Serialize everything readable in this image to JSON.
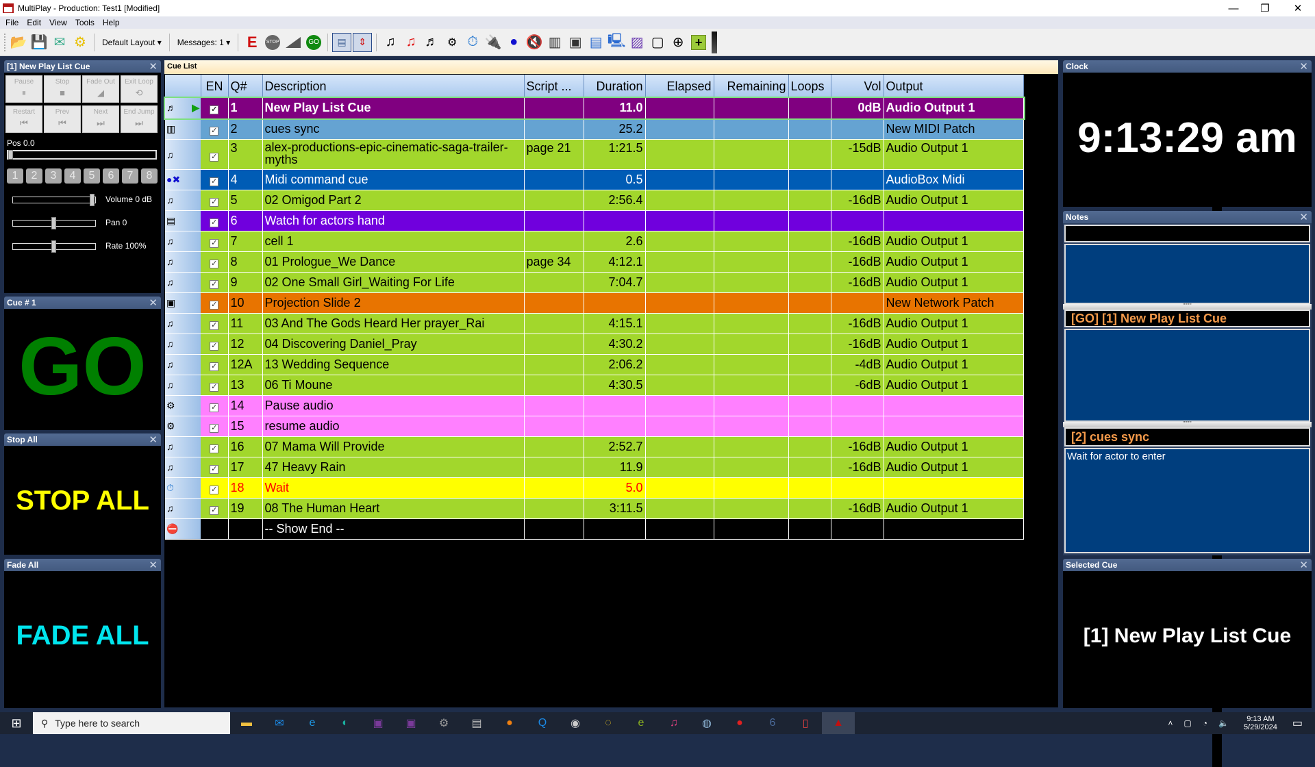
{
  "window": {
    "title": "MultiPlay - Production: Test1 [Modified]",
    "controls": {
      "minimize": "—",
      "restore": "❐",
      "close": "✕"
    }
  },
  "menu": [
    "File",
    "Edit",
    "View",
    "Tools",
    "Help"
  ],
  "toolbar": {
    "layout_dropdown": "Default Layout",
    "messages_dropdown": "Messages: 1",
    "icons": [
      "open-folder-icon",
      "save-icon",
      "export-icon",
      "settings-gear-icon",
      "edit-e-icon",
      "stop-icon",
      "fade-icon",
      "go-icon",
      "list-view-icon",
      "collapse-icon",
      "audio-cue-icon",
      "audio-cue-red-icon",
      "playlist-cue-icon",
      "control-cue-icon",
      "wait-cue-icon",
      "usb-cue-icon",
      "midi-cue-icon",
      "midi-stop-icon",
      "piano-icon",
      "network-cue-icon",
      "text-doc-icon",
      "computer-settings-icon",
      "image-cue-icon",
      "comment-icon",
      "globe-icon",
      "add-icon"
    ]
  },
  "left_panels": {
    "playback": {
      "title": "[1] New Play List Cue",
      "buttons": [
        {
          "label": "Pause",
          "icon": "⏸"
        },
        {
          "label": "Stop",
          "icon": "■"
        },
        {
          "label": "Fade Out",
          "icon": "◢"
        },
        {
          "label": "Exit Loop",
          "icon": "⟲"
        },
        {
          "label": "Restart",
          "icon": "⏮"
        },
        {
          "label": "Prev",
          "icon": "⏮"
        },
        {
          "label": "Next",
          "icon": "⏭"
        },
        {
          "label": "End Jump",
          "icon": "⏭"
        }
      ],
      "position_label": "Pos 0.0",
      "position_fraction": 0.0,
      "number_buttons": [
        "1",
        "2",
        "3",
        "4",
        "5",
        "6",
        "7",
        "8"
      ],
      "volume_label": "Volume 0 dB",
      "volume_fraction": 1.0,
      "pan_label": "Pan 0",
      "pan_fraction": 0.5,
      "rate_label": "Rate 100%",
      "rate_fraction": 0.5
    },
    "cue_number": {
      "title": "Cue # 1",
      "text": "GO",
      "color": "#008000"
    },
    "stop_all": {
      "title": "Stop All",
      "text": "STOP ALL",
      "color": "#ffff00"
    },
    "fade_all": {
      "title": "Fade All",
      "text": "FADE ALL",
      "color": "#00e5ee"
    }
  },
  "cue_list": {
    "title": "Cue List",
    "columns": [
      "",
      "EN",
      "Q#",
      "Description",
      "Script ...",
      "Duration",
      "Elapsed",
      "Remaining",
      "Loops",
      "Vol",
      "Output"
    ],
    "rows": [
      {
        "icon": "♬",
        "type": "playlist-cue-icon",
        "running": true,
        "en": true,
        "q": "1",
        "desc": "New Play List Cue",
        "script": "",
        "duration": "11.0",
        "elapsed": "",
        "remaining": "",
        "loops": "",
        "vol": "0dB",
        "output": "Audio Output 1",
        "bg": "#800080",
        "fg": "#ffffff",
        "bold": true
      },
      {
        "icon": "▥",
        "type": "midi-piano-icon",
        "en": true,
        "q": "2",
        "desc": "cues sync",
        "script": "",
        "duration": "25.2",
        "elapsed": "",
        "remaining": "",
        "loops": "",
        "vol": "",
        "output": "New MIDI Patch",
        "bg": "#65a3d2",
        "fg": "#000000"
      },
      {
        "icon": "♫",
        "type": "audio-cue-icon",
        "en": true,
        "q": "3",
        "desc": "alex-productions-epic-cinematic-saga-trailer-myths",
        "script": "page 21",
        "duration": "1:21.5",
        "elapsed": "",
        "remaining": "",
        "loops": "",
        "vol": "-15dB",
        "output": "Audio Output 1",
        "bg": "#a2d72c",
        "fg": "#000000",
        "tall": true
      },
      {
        "icon": "●✖",
        "type": "midi-command-icon",
        "en": true,
        "q": "4",
        "desc": "Midi command cue",
        "script": "",
        "duration": "0.5",
        "elapsed": "",
        "remaining": "",
        "loops": "",
        "vol": "",
        "output": "AudioBox Midi",
        "bg": "#005cb5",
        "fg": "#ffffff"
      },
      {
        "icon": "♫",
        "type": "audio-cue-icon",
        "en": true,
        "q": "5",
        "desc": "02 Omigod Part 2",
        "script": "",
        "duration": "2:56.4",
        "elapsed": "",
        "remaining": "",
        "loops": "",
        "vol": "-16dB",
        "output": "Audio Output 1",
        "bg": "#a2d72c",
        "fg": "#000000"
      },
      {
        "icon": "▤",
        "type": "text-cue-icon",
        "en": true,
        "q": "6",
        "desc": "Watch for actors hand",
        "script": "",
        "duration": "",
        "elapsed": "",
        "remaining": "",
        "loops": "",
        "vol": "",
        "output": "",
        "bg": "#7000dd",
        "fg": "#ffffff"
      },
      {
        "icon": "♫",
        "type": "audio-cue-icon",
        "en": true,
        "q": "7",
        "desc": "cell 1",
        "script": "",
        "duration": "2.6",
        "elapsed": "",
        "remaining": "",
        "loops": "",
        "vol": "-16dB",
        "output": "Audio Output 1",
        "bg": "#a2d72c",
        "fg": "#000000"
      },
      {
        "icon": "♫",
        "type": "audio-cue-icon",
        "en": true,
        "q": "8",
        "desc": "01 Prologue_We Dance",
        "script": "page 34",
        "duration": "4:12.1",
        "elapsed": "",
        "remaining": "",
        "loops": "",
        "vol": "-16dB",
        "output": "Audio Output 1",
        "bg": "#a2d72c",
        "fg": "#000000"
      },
      {
        "icon": "♫",
        "type": "audio-cue-icon",
        "en": true,
        "q": "9",
        "desc": "02 One Small Girl_Waiting For Life",
        "script": "",
        "duration": "7:04.7",
        "elapsed": "",
        "remaining": "",
        "loops": "",
        "vol": "-16dB",
        "output": "Audio Output 1",
        "bg": "#a2d72c",
        "fg": "#000000"
      },
      {
        "icon": "▣",
        "type": "network-cue-icon",
        "en": true,
        "q": "10",
        "desc": "Projection Slide 2",
        "script": "",
        "duration": "",
        "elapsed": "",
        "remaining": "",
        "loops": "",
        "vol": "",
        "output": "New Network Patch",
        "bg": "#e87400",
        "fg": "#000000"
      },
      {
        "icon": "♫",
        "type": "audio-cue-icon",
        "en": true,
        "q": "11",
        "desc": "03 And The Gods Heard Her prayer_Rai",
        "script": "",
        "duration": "4:15.1",
        "elapsed": "",
        "remaining": "",
        "loops": "",
        "vol": "-16dB",
        "output": "Audio Output 1",
        "bg": "#a2d72c",
        "fg": "#000000"
      },
      {
        "icon": "♫",
        "type": "audio-cue-icon",
        "en": true,
        "q": "12",
        "desc": "04 Discovering Daniel_Pray",
        "script": "",
        "duration": "4:30.2",
        "elapsed": "",
        "remaining": "",
        "loops": "",
        "vol": "-16dB",
        "output": "Audio Output 1",
        "bg": "#a2d72c",
        "fg": "#000000"
      },
      {
        "icon": "♫",
        "type": "audio-cue-icon",
        "en": true,
        "q": "12A",
        "desc": "13 Wedding Sequence",
        "script": "",
        "duration": "2:06.2",
        "elapsed": "",
        "remaining": "",
        "loops": "",
        "vol": "-4dB",
        "output": "Audio Output 1",
        "bg": "#a2d72c",
        "fg": "#000000"
      },
      {
        "icon": "♫",
        "type": "audio-cue-icon",
        "en": true,
        "q": "13",
        "desc": "06 Ti Moune",
        "script": "",
        "duration": "4:30.5",
        "elapsed": "",
        "remaining": "",
        "loops": "",
        "vol": "-6dB",
        "output": "Audio Output 1",
        "bg": "#a2d72c",
        "fg": "#000000"
      },
      {
        "icon": "⚙",
        "type": "control-cue-icon",
        "en": true,
        "q": "14",
        "desc": "Pause audio",
        "script": "",
        "duration": "",
        "elapsed": "",
        "remaining": "",
        "loops": "",
        "vol": "",
        "output": "",
        "bg": "#ff80ff",
        "fg": "#000000"
      },
      {
        "icon": "⚙",
        "type": "control-cue-icon",
        "en": true,
        "q": "15",
        "desc": "resume audio",
        "script": "",
        "duration": "",
        "elapsed": "",
        "remaining": "",
        "loops": "",
        "vol": "",
        "output": "",
        "bg": "#ff80ff",
        "fg": "#000000"
      },
      {
        "icon": "♫",
        "type": "audio-cue-icon",
        "en": true,
        "q": "16",
        "desc": "07 Mama Will Provide",
        "script": "",
        "duration": "2:52.7",
        "elapsed": "",
        "remaining": "",
        "loops": "",
        "vol": "-16dB",
        "output": "Audio Output 1",
        "bg": "#a2d72c",
        "fg": "#000000"
      },
      {
        "icon": "♫",
        "type": "audio-cue-icon",
        "en": true,
        "q": "17",
        "desc": "47 Heavy Rain",
        "script": "",
        "duration": "11.9",
        "elapsed": "",
        "remaining": "",
        "loops": "",
        "vol": "-16dB",
        "output": "Audio Output 1",
        "bg": "#a2d72c",
        "fg": "#000000"
      },
      {
        "icon": "⏱",
        "type": "wait-cue-icon",
        "en": true,
        "q": "18",
        "desc": "Wait",
        "script": "",
        "duration": "5.0",
        "elapsed": "",
        "remaining": "",
        "loops": "",
        "vol": "",
        "output": "",
        "bg": "#ffff00",
        "fg": "#ff0000"
      },
      {
        "icon": "♫",
        "type": "audio-cue-icon",
        "en": true,
        "q": "19",
        "desc": "08 The Human Heart",
        "script": "",
        "duration": "3:11.5",
        "elapsed": "",
        "remaining": "",
        "loops": "",
        "vol": "-16dB",
        "output": "Audio Output 1",
        "bg": "#a2d72c",
        "fg": "#000000"
      },
      {
        "icon": "⛔",
        "type": "show-end-icon",
        "en": null,
        "q": "",
        "desc": "-- Show End --",
        "script": "",
        "duration": "",
        "elapsed": "",
        "remaining": "",
        "loops": "",
        "vol": "",
        "output": "",
        "bg": "#000000",
        "fg": "#ffffff"
      }
    ]
  },
  "right_panels": {
    "clock": {
      "title": "Clock",
      "time": "9:13:29 am"
    },
    "notes": {
      "title": "Notes",
      "go_header": "[GO] [1] New Play List Cue",
      "go_note": "",
      "next_header": "[2] cues sync",
      "next_note": "Wait for actor to enter"
    },
    "selected_cue": {
      "title": "Selected Cue",
      "text": "[1] New Play List Cue"
    }
  },
  "taskbar": {
    "search_placeholder": "Type here to search",
    "apps": [
      "file-explorer-icon",
      "mail-icon",
      "ie-icon",
      "edge-icon",
      "teams-record-icon",
      "teams-play-icon",
      "app-icon",
      "network-app-icon",
      "orange-app-icon",
      "q-app-icon",
      "mask-app-icon",
      "q-plus-app-icon",
      "e-app-icon",
      "itunes-icon",
      "3d-app-icon",
      "ladybug-app-icon",
      "app-6-icon",
      "phone-app-icon",
      "multiplay-icon"
    ],
    "time": "9:13 AM",
    "date": "5/29/2024"
  }
}
